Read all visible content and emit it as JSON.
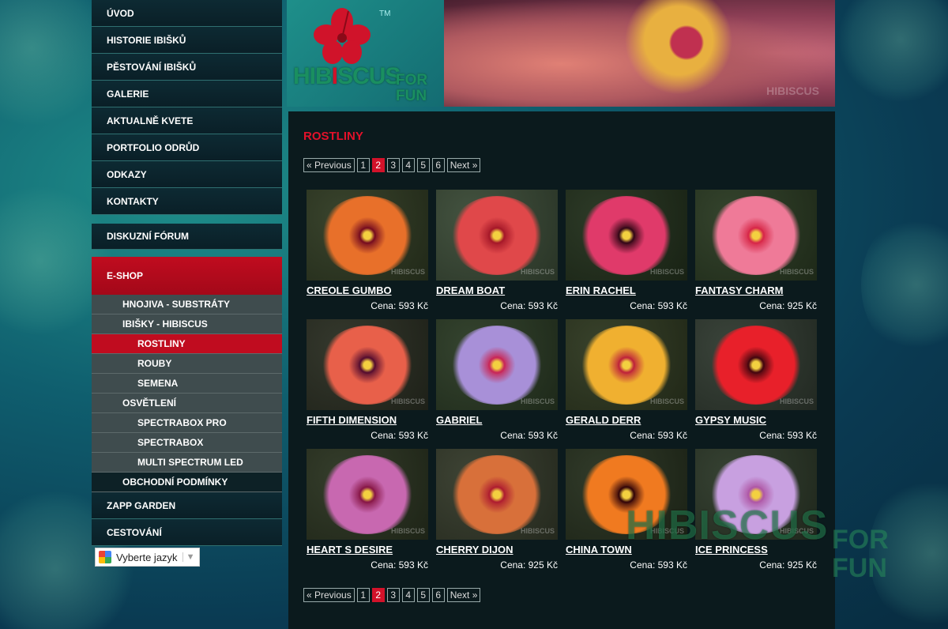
{
  "nav": {
    "main": [
      "ÚVOD",
      "HISTORIE IBIŠKŮ",
      "PĚSTOVÁNÍ IBIŠKŮ",
      "GALERIE",
      "AKTUALNĚ KVETE",
      "PORTFOLIO ODRŮD",
      "ODKAZY",
      "KONTAKTY"
    ],
    "forum": "DISKUZNÍ FÓRUM",
    "eshop": "E-SHOP",
    "sub": [
      {
        "label": "HNOJIVA - SUBSTRÁTY",
        "level": 1
      },
      {
        "label": "IBIŠKY - HIBISCUS",
        "level": 1
      },
      {
        "label": "ROSTLINY",
        "level": 2,
        "active": true
      },
      {
        "label": "ROUBY",
        "level": 2
      },
      {
        "label": "SEMENA",
        "level": 2
      },
      {
        "label": "OSVĚTLENÍ",
        "level": 1
      },
      {
        "label": "SPECTRABOX PRO",
        "level": 2
      },
      {
        "label": "SPECTRABOX",
        "level": 2
      },
      {
        "label": "MULTI SPECTRUM LED",
        "level": 2
      },
      {
        "label": "OBCHODNÍ PODMÍNKY",
        "level": 1,
        "dark": true
      }
    ],
    "after": [
      "ZAPP GARDEN",
      "CESTOVÁNÍ"
    ]
  },
  "translate": {
    "label": "Vyberte jazyk",
    "arrow": "▼"
  },
  "logo": {
    "text_a": "HIB",
    "text_i": "I",
    "text_b": "SCUS",
    "for": "FOR",
    "fun": "FUN",
    "tm": "TM"
  },
  "header_photo_watermark": "HIBISCUS",
  "page_title": "ROSTLINY",
  "pager": {
    "prev": "« Previous",
    "next": "Next »",
    "pages": [
      "1",
      "2",
      "3",
      "4",
      "5",
      "6"
    ],
    "current": "2"
  },
  "products": [
    {
      "name": "CREOLE GUMBO",
      "price": "Cena: 593 Kč",
      "petal": "#e8702a",
      "center": "#7a1020",
      "bg": "#2f3a22"
    },
    {
      "name": "DREAM BOAT",
      "price": "Cena: 593 Kč",
      "petal": "#e0484a",
      "center": "#a81a2a",
      "bg": "#3a4a36"
    },
    {
      "name": "ERIN RACHEL",
      "price": "Cena: 593 Kč",
      "petal": "#e03a6a",
      "center": "#3a0a1a",
      "bg": "#22301c"
    },
    {
      "name": "FANTASY CHARM",
      "price": "Cena: 925 Kč",
      "petal": "#ef7a98",
      "center": "#d82a4a",
      "bg": "#2a3a22"
    },
    {
      "name": "FIFTH DIMENSION",
      "price": "Cena: 593 Kč",
      "petal": "#e8604a",
      "center": "#5a1030",
      "bg": "#2a2e22"
    },
    {
      "name": "GABRIEL",
      "price": "Cena: 593 Kč",
      "petal": "#a890d8",
      "center": "#c82a5a",
      "bg": "#2a3a24"
    },
    {
      "name": "GERALD DERR",
      "price": "Cena: 593 Kč",
      "petal": "#f0b030",
      "center": "#c0283a",
      "bg": "#2e3820"
    },
    {
      "name": "GYPSY MUSIC",
      "price": "Cena: 593 Kč",
      "petal": "#e8202a",
      "center": "#4a0810",
      "bg": "#303a30"
    },
    {
      "name": "HEART S DESIRE",
      "price": "Cena: 593 Kč",
      "petal": "#c868b0",
      "center": "#8a1a4a",
      "bg": "#2a3320"
    },
    {
      "name": "CHERRY DIJON",
      "price": "Cena: 925 Kč",
      "petal": "#d8703a",
      "center": "#b02030",
      "bg": "#343a2a"
    },
    {
      "name": "CHINA TOWN",
      "price": "Cena: 593 Kč",
      "petal": "#f07a20",
      "center": "#3a0a0a",
      "bg": "#26301e"
    },
    {
      "name": "ICE PRINCESS",
      "price": "Cena: 925 Kč",
      "petal": "#c8a0e0",
      "center": "#b05aa8",
      "bg": "#2c3828"
    }
  ],
  "photo_watermark": "HIBISCUS",
  "big_watermark": {
    "main": "HIBISCUS",
    "for": "FOR",
    "fun": "FUN"
  }
}
